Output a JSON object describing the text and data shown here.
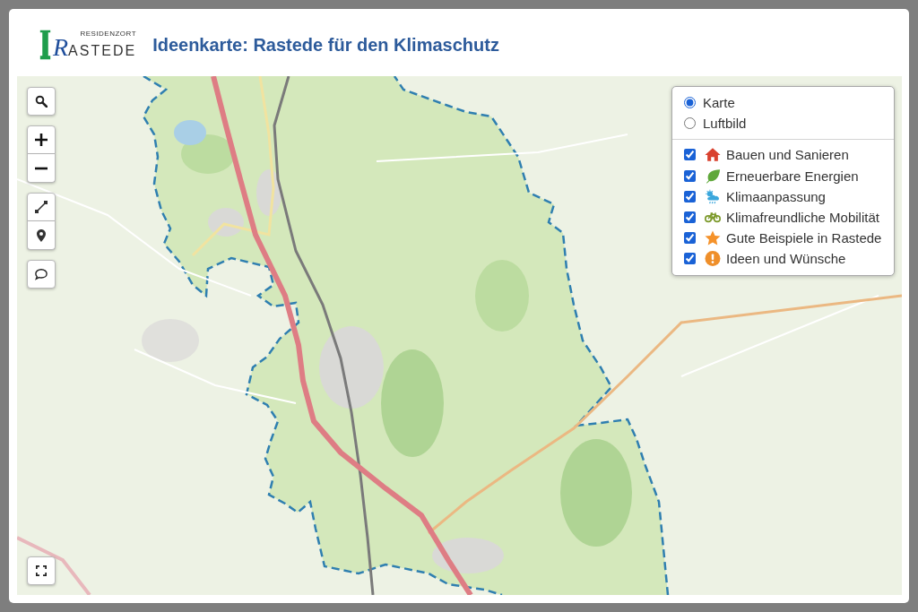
{
  "header": {
    "logo": {
      "tagline": "RESIDENZORT",
      "wordmark": "RASTEDE"
    },
    "title": "Ideenkarte: Rastede für den Klimaschutz"
  },
  "layer_panel": {
    "base_layers": [
      {
        "label": "Karte",
        "selected": true
      },
      {
        "label": "Luftbild",
        "selected": false
      }
    ],
    "overlays": [
      {
        "label": "Bauen und Sanieren",
        "checked": true,
        "color": "#d9412e"
      },
      {
        "label": "Erneuerbare Energien",
        "checked": true,
        "color": "#5fa83a"
      },
      {
        "label": "Klimaanpassung",
        "checked": true,
        "color": "#3ba7dc"
      },
      {
        "label": "Klimafreundliche Mobilität",
        "checked": true,
        "color": "#7d9a2c"
      },
      {
        "label": "Gute Beispiele in Rastede",
        "checked": true,
        "color": "#f5922a"
      },
      {
        "label": "Ideen und Wünsche",
        "checked": true,
        "color": "#ef8f2a"
      }
    ]
  }
}
